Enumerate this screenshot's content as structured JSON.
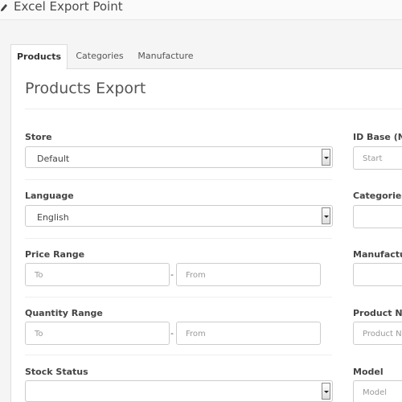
{
  "header": {
    "title": "Excel Export Point",
    "icon": "pencil-icon"
  },
  "tabs": [
    {
      "label": "Products",
      "active": true
    },
    {
      "label": "Categories",
      "active": false
    },
    {
      "label": "Manufacture",
      "active": false
    }
  ],
  "page_title": "Products Export",
  "left_fields": {
    "store": {
      "label": "Store",
      "value": "Default"
    },
    "language": {
      "label": "Language",
      "value": "English"
    },
    "price_range": {
      "label": "Price Range",
      "to_placeholder": "To",
      "from_placeholder": "From",
      "separator": "-"
    },
    "quantity_range": {
      "label": "Quantity Range",
      "to_placeholder": "To",
      "from_placeholder": "From",
      "separator": "-"
    },
    "stock_status": {
      "label": "Stock Status",
      "value": ""
    }
  },
  "right_fields": {
    "id_base": {
      "label": "ID Base (Note",
      "placeholder": "Start"
    },
    "categories": {
      "label": "Categories",
      "placeholder": ""
    },
    "manufacturer": {
      "label": "Manufacture",
      "placeholder": ""
    },
    "product_name": {
      "label": "Product Nam",
      "placeholder": "Product Na"
    },
    "model": {
      "label": "Model",
      "placeholder": "Model"
    }
  }
}
